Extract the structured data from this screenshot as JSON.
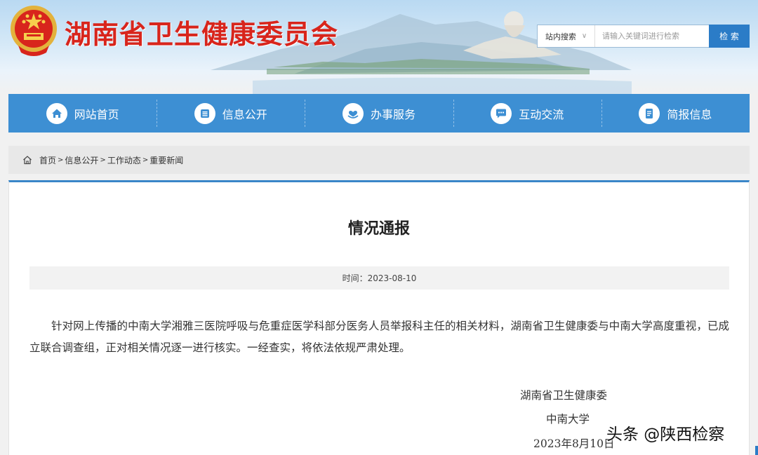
{
  "header": {
    "site_title": "湖南省卫生健康委员会",
    "search": {
      "scope_label": "站内搜索",
      "placeholder": "请输入关键词进行检索",
      "button_label": "检 索"
    }
  },
  "nav": {
    "items": [
      {
        "label": "网站首页",
        "icon": "home-icon"
      },
      {
        "label": "信息公开",
        "icon": "document-icon"
      },
      {
        "label": "办事服务",
        "icon": "heart-hand-icon"
      },
      {
        "label": "互动交流",
        "icon": "chat-icon"
      },
      {
        "label": "简报信息",
        "icon": "report-icon"
      }
    ]
  },
  "breadcrumb": {
    "items": [
      "首页",
      "信息公开",
      "工作动态",
      "重要新闻"
    ],
    "separator": ">"
  },
  "article": {
    "title": "情况通报",
    "meta": "时间：2023-08-10",
    "body": "针对网上传播的中南大学湘雅三医院呼吸与危重症医学科部分医务人员举报科主任的相关材料，湖南省卫生健康委与中南大学高度重视，已成立联合调查组，正对相关情况逐一进行核实。一经查实，将依法依规严肃处理。",
    "signatures": [
      "湖南省卫生健康委",
      "中南大学",
      "2023年8月10日"
    ]
  },
  "watermark": "头条 @陕西检察",
  "colors": {
    "title_red": "#d8251c",
    "nav_blue": "#3d8fd3",
    "accent_blue": "#3a86c8",
    "search_button": "#2b7cc7"
  }
}
